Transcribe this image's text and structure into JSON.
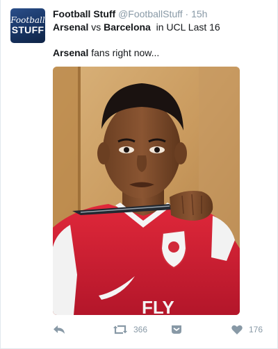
{
  "tweet": {
    "author_avatar_text": {
      "top": "Football",
      "bottom": "STUFF"
    },
    "author_name": "Football Stuff",
    "author_handle": "@FootballStuff",
    "separator": "·",
    "timestamp": "15h",
    "context": {
      "team1": "Arsenal",
      "vs": " vs ",
      "team2": "Barcelona",
      "rest": "  in UCL Last 16"
    },
    "text": {
      "bold": "Arsenal",
      "rest": " fans right now..."
    },
    "photo_icon": "photo-of-fan-in-arsenal-shirt-with-knife",
    "actions": {
      "reply_icon": "reply-icon",
      "retweet_icon": "retweet-icon",
      "retweet_count": "366",
      "dm_icon": "direct-message-icon",
      "like_icon": "heart-icon",
      "like_count": "176"
    }
  },
  "colors": {
    "text": "#14171a",
    "muted": "#8899a6",
    "avatar_bg": "#1b3a6b",
    "border": "#e1e8ed"
  }
}
